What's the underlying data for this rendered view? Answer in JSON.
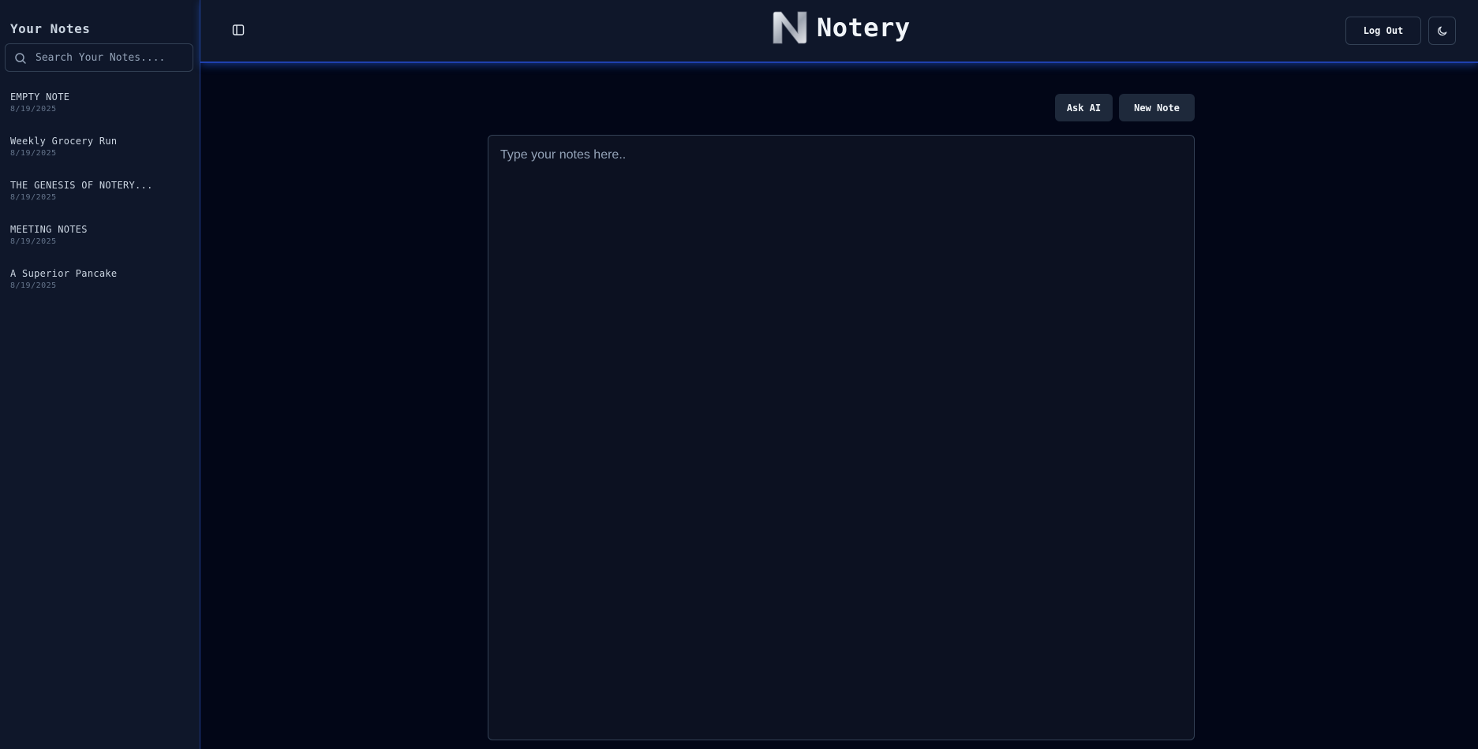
{
  "sidebar": {
    "title": "Your Notes",
    "search": {
      "placeholder": "Search Your Notes...."
    },
    "notes": [
      {
        "title": "EMPTY NOTE",
        "date": "8/19/2025"
      },
      {
        "title": "Weekly Grocery Run",
        "date": "8/19/2025"
      },
      {
        "title": "THE GENESIS OF NOTERY...",
        "date": "8/19/2025"
      },
      {
        "title": "MEETING NOTES",
        "date": "8/19/2025"
      },
      {
        "title": "A Superior Pancake",
        "date": "8/19/2025"
      }
    ]
  },
  "header": {
    "brand": "Notery",
    "logo_letter": "N",
    "logout_label": "Log Out",
    "icons": {
      "toggle": "sidebar-toggle-icon",
      "theme": "moon-icon"
    }
  },
  "main": {
    "ask_ai_label": "Ask AI",
    "new_note_label": "New Note",
    "editor": {
      "placeholder": "Type your notes here..",
      "value": ""
    }
  },
  "colors": {
    "background": "#020617",
    "panel": "#0f172a",
    "accent_glow": "#1e40af",
    "button": "#1e293b",
    "border": "#334155"
  }
}
